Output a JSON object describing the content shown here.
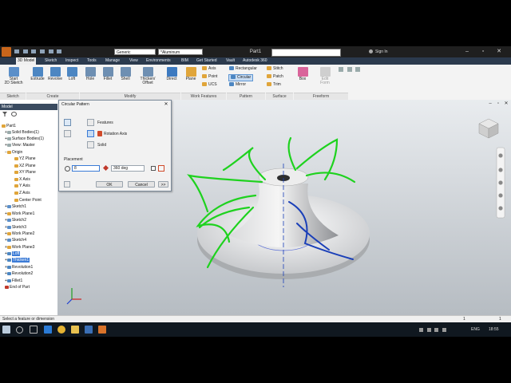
{
  "titlebar": {
    "style_selector": "Generic",
    "material_selector": "*Aluminum",
    "document_tab": "Part1",
    "sign_in": "Sign In"
  },
  "tabs": [
    "3D Model",
    "Sketch",
    "Inspect",
    "Tools",
    "Manage",
    "View",
    "Environments",
    "BIM",
    "Get Started",
    "Vault",
    "Autodesk 360"
  ],
  "ribbon": {
    "start_sketch": "Start\n2D Sketch",
    "extrude": "Extrude",
    "revolve": "Revolve",
    "loft": "Loft",
    "hole": "Hole",
    "fillet": "Fillet",
    "shell": "Shell",
    "thicken": "Thicken/\nOffset",
    "direct": "Direct",
    "plane": "Plane",
    "axis": "Axis",
    "point": "Point",
    "ucs": "UCS",
    "rectangular": "Rectangular",
    "circular": "Circular",
    "mirror": "Mirror",
    "stitch": "Stitch",
    "patch": "Patch",
    "trim": "Trim",
    "box": "Box",
    "edit_form": "Edit\nForm",
    "groups": [
      "Sketch",
      "Create",
      "Modify",
      "Work Features",
      "Pattern",
      "Surface",
      "Freeform"
    ]
  },
  "browser": {
    "title": "Model",
    "items": [
      "Part1",
      "Solid Bodies(1)",
      "Surface Bodies(1)",
      "View: Master",
      "Origin",
      "YZ Plane",
      "XZ Plane",
      "XY Plane",
      "X Axis",
      "Y Axis",
      "Z Axis",
      "Center Point",
      "Sketch1",
      "Work Plane1",
      "Sketch2",
      "Sketch3",
      "Work Plane2",
      "Sketch4",
      "Work Plane3",
      "Loft",
      "Thicken1",
      "Revolution1",
      "Revolution2",
      "Fillet1",
      "End of Part"
    ]
  },
  "dialog": {
    "title": "Circular Pattern",
    "features_label": "Features",
    "rotation_axis_label": "Rotation Axis",
    "solid_label": "Solid",
    "placement_label": "Placement",
    "count_value": "8",
    "angle_value": "360 deg",
    "ok": "OK",
    "cancel": "Cancel",
    "more": ">>"
  },
  "statusbar": {
    "message": "Select a feature or dimension",
    "count1": "1",
    "count2": "1"
  },
  "taskbar": {
    "language": "ENG",
    "time": "18:55"
  },
  "colors": {
    "tabs_bg": "#2b3a4d",
    "selection_blue": "#3b7bd6",
    "curve_green": "#1ed21e",
    "curve_blue": "#1a3fb8"
  }
}
